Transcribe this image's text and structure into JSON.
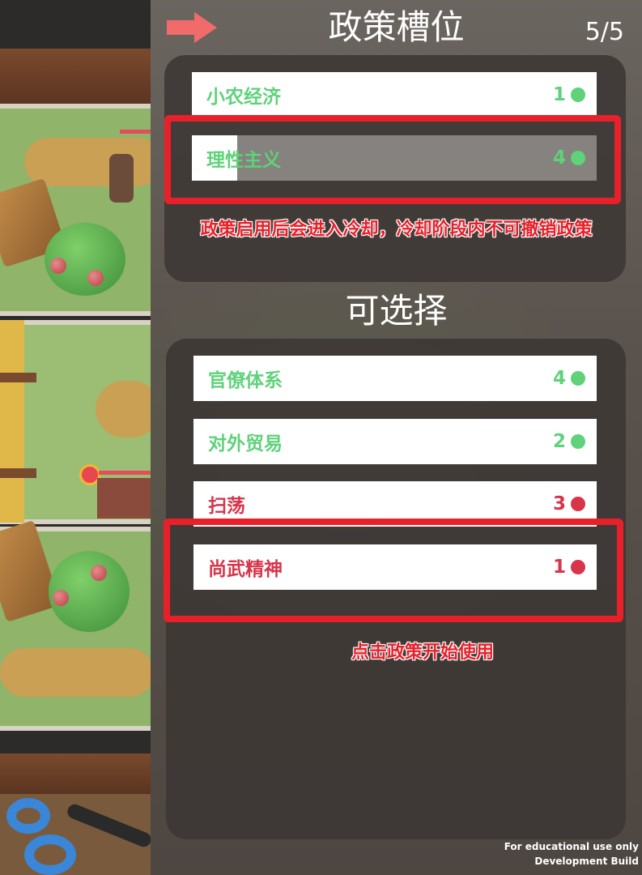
{
  "header": {
    "title": "政策槽位",
    "counter": "5/5",
    "back_icon": "right-arrow-icon",
    "accent": "#f26b6b"
  },
  "slots": {
    "items": [
      {
        "label": "小农经济",
        "cost": "1",
        "status": "green"
      },
      {
        "label": "理性主义",
        "cost": "4",
        "status": "green"
      }
    ]
  },
  "available": {
    "title": "可选择",
    "items": [
      {
        "label": "官僚体系",
        "cost": "4",
        "status": "green"
      },
      {
        "label": "对外贸易",
        "cost": "2",
        "status": "green"
      },
      {
        "label": "扫荡",
        "cost": "3",
        "status": "red"
      },
      {
        "label": "尚武精神",
        "cost": "1",
        "status": "red"
      }
    ]
  },
  "annotations": {
    "cooldown_tip": "政策启用后会进入冷却，冷却阶段内不可撤销政策",
    "click_tip": "点击政策开始使用",
    "highlight_color": "#e8202a"
  },
  "build_note": {
    "line1": "For educational use only",
    "line2": "Development Build"
  },
  "colors": {
    "available_green": "#5fd27a",
    "unavailable_red": "#d8344a"
  }
}
